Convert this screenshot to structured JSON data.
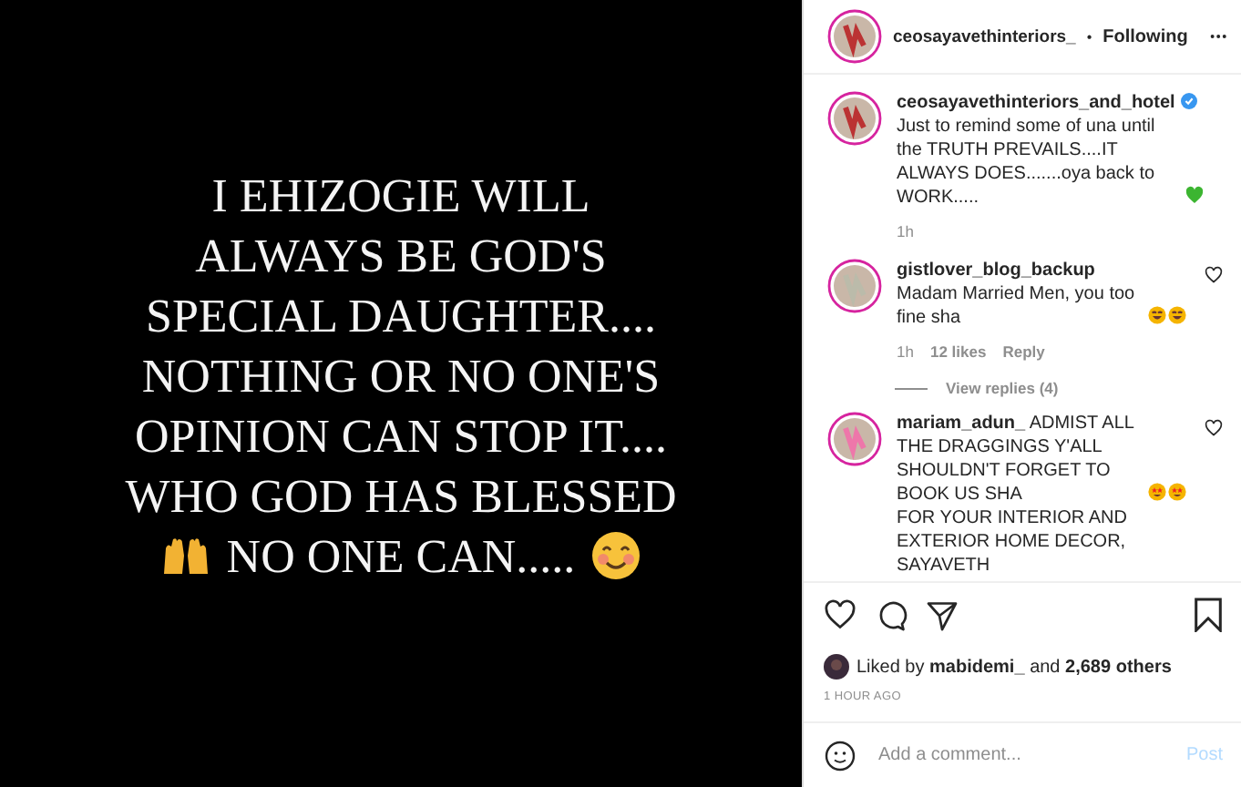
{
  "post_image": {
    "lines": [
      "I EHIZOGIE WILL",
      "ALWAYS BE GOD'S",
      "SPECIAL DAUGHTER....",
      "NOTHING OR NO ONE'S",
      "OPINION CAN STOP IT....",
      "WHO GOD HAS BLESSED"
    ],
    "last_line": "NO ONE CAN....."
  },
  "header": {
    "username": "ceosayavethinteriors_",
    "separator": "•",
    "follow_label": "Following"
  },
  "caption": {
    "username": "ceosayavethinteriors_and_hotel",
    "verified": true,
    "text": "Just to remind some of una until the TRUTH PREVAILS....IT ALWAYS DOES.......oya back to WORK.....",
    "time": "1h"
  },
  "comments": [
    {
      "text": "**gistlover_blog_backup** Madam Married Men, you too fine sha",
      "emojis": [
        {
          "kind": "laughing"
        },
        {
          "kind": "laughing"
        }
      ],
      "time": "1h",
      "likes": "12 likes",
      "reply": "Reply",
      "view_replies": "View replies (4)"
    },
    {
      "text": "**mariam_adun_** ADMIST ALL THE DRAGGINGS Y'ALL SHOULDN'T FORGET TO BOOK US SHA",
      "emojis": [
        {
          "kind": "star-eyes"
        },
        {
          "kind": "star-eyes"
        }
      ],
      "more": "FOR YOUR INTERIOR AND EXTERIOR HOME DECOR, SAYAVETH"
    }
  ],
  "likes": {
    "prefix": "Liked by",
    "user": "mabidemi_",
    "middle": "and",
    "count": "2,689 others"
  },
  "time_ago": "1 HOUR AGO",
  "comment_box": {
    "placeholder": "Add a comment...",
    "post_label": "Post"
  }
}
